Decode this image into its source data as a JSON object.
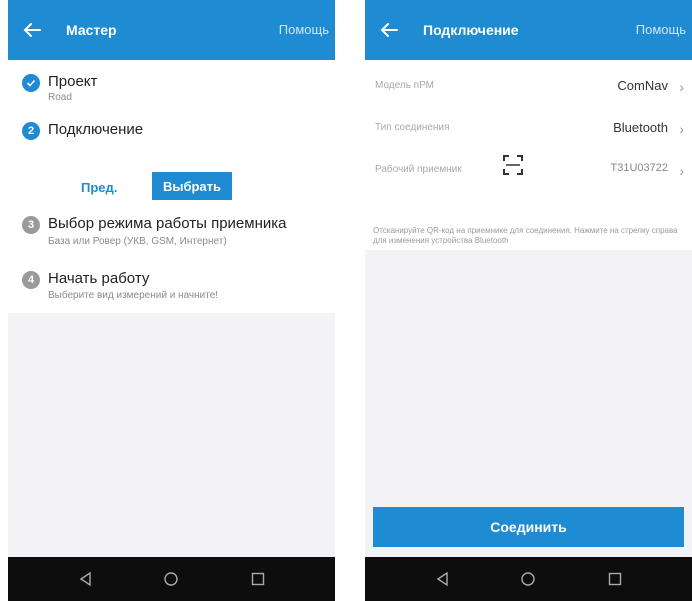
{
  "left": {
    "appbar": {
      "title": "Мастер",
      "help": "Помощь"
    },
    "steps": [
      {
        "number": "1",
        "title": "Проект",
        "subtitle": "Road",
        "status": "done"
      },
      {
        "number": "2",
        "title": "Подключение",
        "subtitle": "",
        "status": "active"
      },
      {
        "number": "3",
        "title": "Выбор режима работы приемника",
        "subtitle": "База или Ровер (УКВ, GSM, Интернет)",
        "status": "pending"
      },
      {
        "number": "4",
        "title": "Начать работу",
        "subtitle": "Выберите вид измерений и начните!",
        "status": "pending"
      }
    ],
    "buttons": {
      "prev": "Пред.",
      "select": "Выбрать"
    }
  },
  "right": {
    "appbar": {
      "title": "Подключение",
      "help": "Помощь"
    },
    "rows": [
      {
        "label": "Модель пРМ",
        "value": "ComNav"
      },
      {
        "label": "Тип соединения",
        "value": "Bluetooth"
      },
      {
        "label": "Рабочий приемник",
        "value": "T31U03722"
      }
    ],
    "hint": "Отсканируйте QR-код на приемнике для соединения. Нажмите на стрелку справа для изменения устройства Bluetooth",
    "connect_button": "Соединить"
  },
  "icons": {
    "back": "arrow-left-icon",
    "check": "check-icon",
    "qr": "qr-scan-icon",
    "nav_back": "triangle-back-icon",
    "nav_home": "circle-home-icon",
    "nav_recent": "square-recent-icon"
  },
  "colors": {
    "accent": "#1f8bd2",
    "navbar": "#0d0d0d",
    "background": "#f3f3f5"
  }
}
